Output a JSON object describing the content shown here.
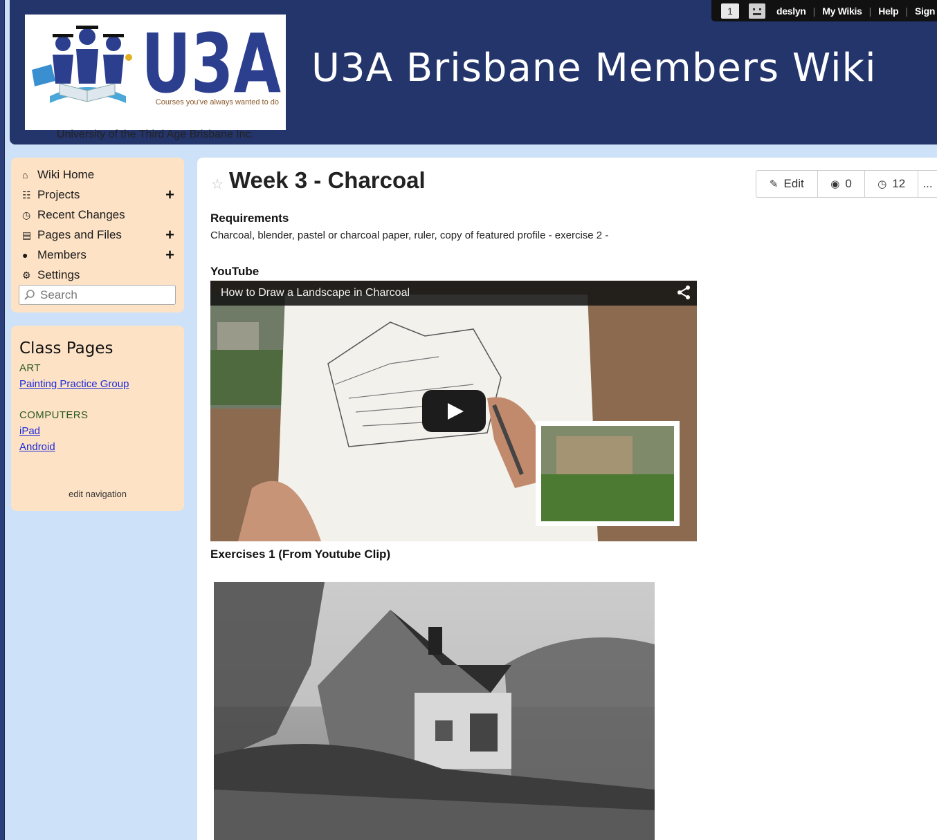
{
  "header": {
    "site_title": "U3A Brisbane Members Wiki",
    "logo_text": "U3A",
    "logo_tagline": "Courses you've always wanted to do",
    "logo_subtitle": "University of the Third Age Brisbane Inc."
  },
  "userbar": {
    "notification_count": "1",
    "username": "deslyn",
    "my_wikis": "My Wikis",
    "help": "Help",
    "sign": "Sign"
  },
  "nav": {
    "items": [
      {
        "label": "Wiki Home",
        "icon": "home-icon"
      },
      {
        "label": "Projects",
        "icon": "sitemap-icon",
        "plus": "+"
      },
      {
        "label": "Recent Changes",
        "icon": "clock-icon"
      },
      {
        "label": "Pages and Files",
        "icon": "file-icon",
        "plus": "+"
      },
      {
        "label": "Members",
        "icon": "user-icon",
        "plus": "+"
      },
      {
        "label": "Settings",
        "icon": "gear-icon"
      }
    ],
    "search_placeholder": "Search"
  },
  "class_pages": {
    "title": "Class Pages",
    "categories": [
      {
        "name": "ART",
        "links": [
          "Painting Practice Group"
        ]
      },
      {
        "name": "COMPUTERS",
        "links": [
          "iPad",
          "Android"
        ]
      }
    ],
    "edit_navigation": "edit navigation"
  },
  "page": {
    "title": "Week 3 - Charcoal",
    "actions": {
      "edit": "Edit",
      "comments": "0",
      "revisions": "12",
      "more": "..."
    },
    "requirements_heading": "Requirements",
    "requirements_text": "Charcoal, blender, pastel or charcoal paper, ruler, copy of featured profile - exercise 2 -",
    "youtube_heading": "YouTube",
    "video_title": "How to Draw a Landscape in Charcoal",
    "exercises_heading": "Exercises 1 (From Youtube Clip)"
  },
  "colors": {
    "header_bg": "#24356b",
    "page_bg": "#cde2f8",
    "sidebar_bg": "#fde2c6",
    "link": "#1a2ad8"
  }
}
